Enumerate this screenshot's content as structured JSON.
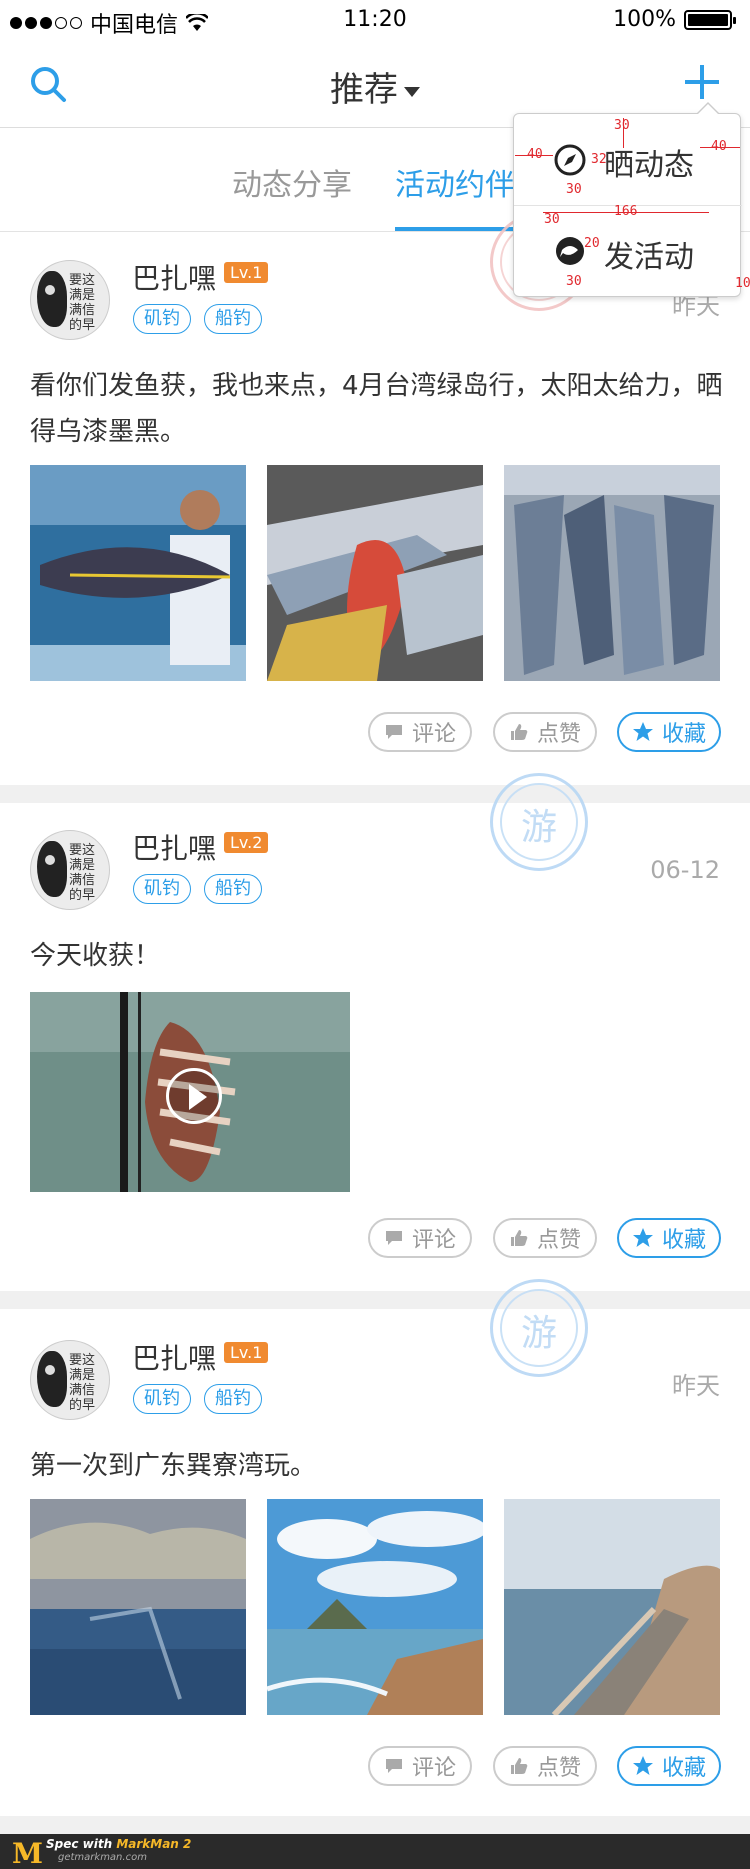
{
  "status_bar": {
    "carrier": "中国电信",
    "time": "11:20",
    "battery": "100%"
  },
  "nav": {
    "title": "推荐"
  },
  "tabs": [
    {
      "label": "动态分享"
    },
    {
      "label": "活动约伴"
    }
  ],
  "menu": {
    "items": [
      {
        "label": "晒动态"
      },
      {
        "label": "发活动"
      }
    ],
    "spec": {
      "a": "30",
      "b": "40",
      "c": "32",
      "d": "40",
      "e": "30",
      "f": "166",
      "g": "30",
      "h": "20",
      "i": "30",
      "j": "10"
    }
  },
  "avatar_chars": "要这满是满信的早",
  "stamp_text": "游",
  "buttons": {
    "comment": "评论",
    "like": "点赞",
    "favorite": "收藏"
  },
  "posts": [
    {
      "username": "巴扎嘿",
      "level": "Lv.1",
      "tags": [
        "矶钓",
        "船钓"
      ],
      "date": "昨天",
      "text": "看你们发鱼获，我也来点，4月台湾绿岛行，太阳太给力，晒得乌漆墨黑。"
    },
    {
      "username": "巴扎嘿",
      "level": "Lv.2",
      "tags": [
        "矶钓",
        "船钓"
      ],
      "date": "06-12",
      "text": "今天收获！"
    },
    {
      "username": "巴扎嘿",
      "level": "Lv.1",
      "tags": [
        "矶钓",
        "船钓"
      ],
      "date": "昨天",
      "text": "第一次到广东巽寮湾玩。"
    }
  ],
  "footer": {
    "brand": "M",
    "spec_with": "Spec with",
    "product": "MarkMan 2",
    "site": "getmarkman.com"
  },
  "colors": {
    "accent": "#2d9ee8",
    "level_badge": "#f08a30",
    "spec_red": "#e0282e"
  }
}
